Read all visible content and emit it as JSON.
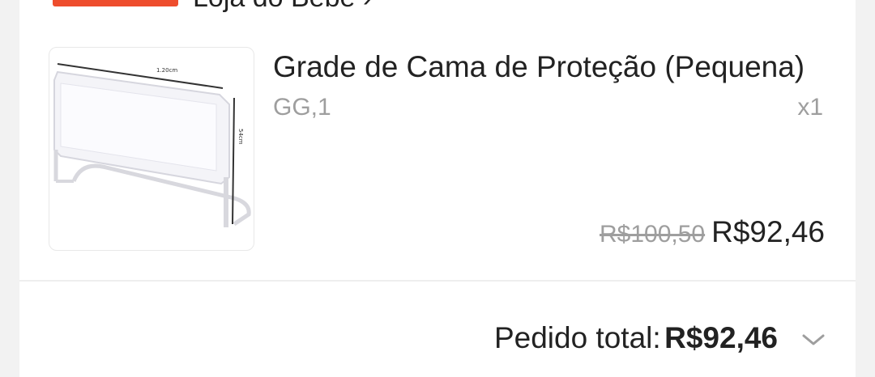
{
  "shop": {
    "name": "Loja do Bebê ›"
  },
  "product": {
    "title": "Grade de Cama de Proteção (Pequena)",
    "variation": "GG,1",
    "quantity": "x1",
    "original_price": "R$100,50",
    "price": "R$92,46",
    "image": {
      "dim_width_label": "1.20cm",
      "dim_height_label": "54cm"
    }
  },
  "order": {
    "total_label": "Pedido total:",
    "total_value": "R$92,46"
  },
  "icons": {
    "expand": "chevron-down-icon"
  },
  "colors": {
    "accent": "#ee4d2d",
    "text": "#222222",
    "muted": "#9e9e9e"
  }
}
